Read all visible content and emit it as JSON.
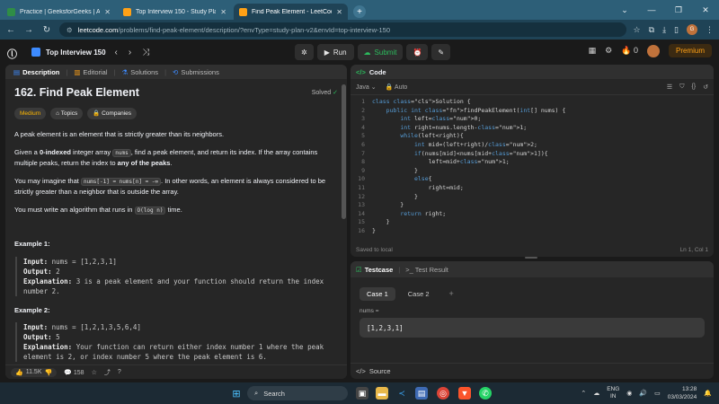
{
  "browser": {
    "tabs": [
      {
        "title": "Practice | GeeksforGeeks | A co",
        "favicon_color": "#2f8d46"
      },
      {
        "title": "Top Interview 150 - Study Plan",
        "favicon_color": "#ffa116"
      },
      {
        "title": "Find Peak Element - LeetCode",
        "favicon_color": "#ffa116"
      }
    ],
    "url_domain": "leetcode.com",
    "url_path": "/problems/find-peak-element/description/?envType=study-plan-v2&envId=top-interview-150",
    "profile_initial": "G"
  },
  "nav": {
    "list_name": "Top Interview 150",
    "run_label": "Run",
    "submit_label": "Submit",
    "streak": "0",
    "premium_label": "Premium"
  },
  "left": {
    "tabs": [
      "Description",
      "Editorial",
      "Solutions",
      "Submissions"
    ],
    "title": "162. Find Peak Element",
    "solved_label": "Solved",
    "difficulty": "Medium",
    "tag_topics": "Topics",
    "tag_companies": "Companies",
    "p1": "A peak element is an element that is strictly greater than its neighbors.",
    "p2_a": "Given a ",
    "p2_b": "0-indexed",
    "p2_c": " integer array ",
    "p2_code": "nums",
    "p2_d": ", find a peak element, and return its index. If the array contains multiple peaks, return the index to ",
    "p2_e": "any of the peaks",
    "p2_f": ".",
    "p3_a": "You may imagine that ",
    "p3_code": "nums[-1] = nums[n] = -∞",
    "p3_b": ". In other words, an element is always considered to be strictly greater than a neighbor that is outside the array.",
    "p4_a": "You must write an algorithm that runs in ",
    "p4_code": "O(log n)",
    "p4_b": " time.",
    "examples": [
      {
        "heading": "Example 1:",
        "input_label": "Input:",
        "input": " nums = [1,2,3,1]",
        "output_label": "Output:",
        "output": " 2",
        "expl_label": "Explanation:",
        "expl": " 3 is a peak element and your function should return the index number 2."
      },
      {
        "heading": "Example 2:",
        "input_label": "Input:",
        "input": " nums = [1,2,1,3,5,6,4]",
        "output_label": "Output:",
        "output": " 5",
        "expl_label": "Explanation:",
        "expl": " Your function can return either index number 1 where the peak element is 2, or index number 5 where the peak element is 6."
      }
    ],
    "likes": "11.5K",
    "comments": "158"
  },
  "code": {
    "header": "Code",
    "language": "Java",
    "mode": "Auto",
    "saved": "Saved to local",
    "cursor": "Ln 1, Col 1",
    "lines": [
      "class Solution {",
      "    public int findPeakElement(int[] nums) {",
      "        int left=0;",
      "        int right=nums.length-1;",
      "        while(left<right){",
      "            int mid=(left+right)/2;",
      "            if(nums[mid]<nums[mid+1]){",
      "                left=mid+1;",
      "            }",
      "            else{",
      "                right=mid;",
      "            }",
      "        }",
      "        return right;",
      "    }",
      "}"
    ]
  },
  "test": {
    "tab_testcase": "Testcase",
    "tab_result": "Test Result",
    "cases": [
      "Case 1",
      "Case 2"
    ],
    "input_label": "nums =",
    "input_value": "[1,2,3,1]",
    "source_label": "Source"
  },
  "taskbar": {
    "search_placeholder": "Search",
    "lang_top": "ENG",
    "lang_bottom": "IN",
    "time": "13:28",
    "date": "03/03/2024"
  }
}
